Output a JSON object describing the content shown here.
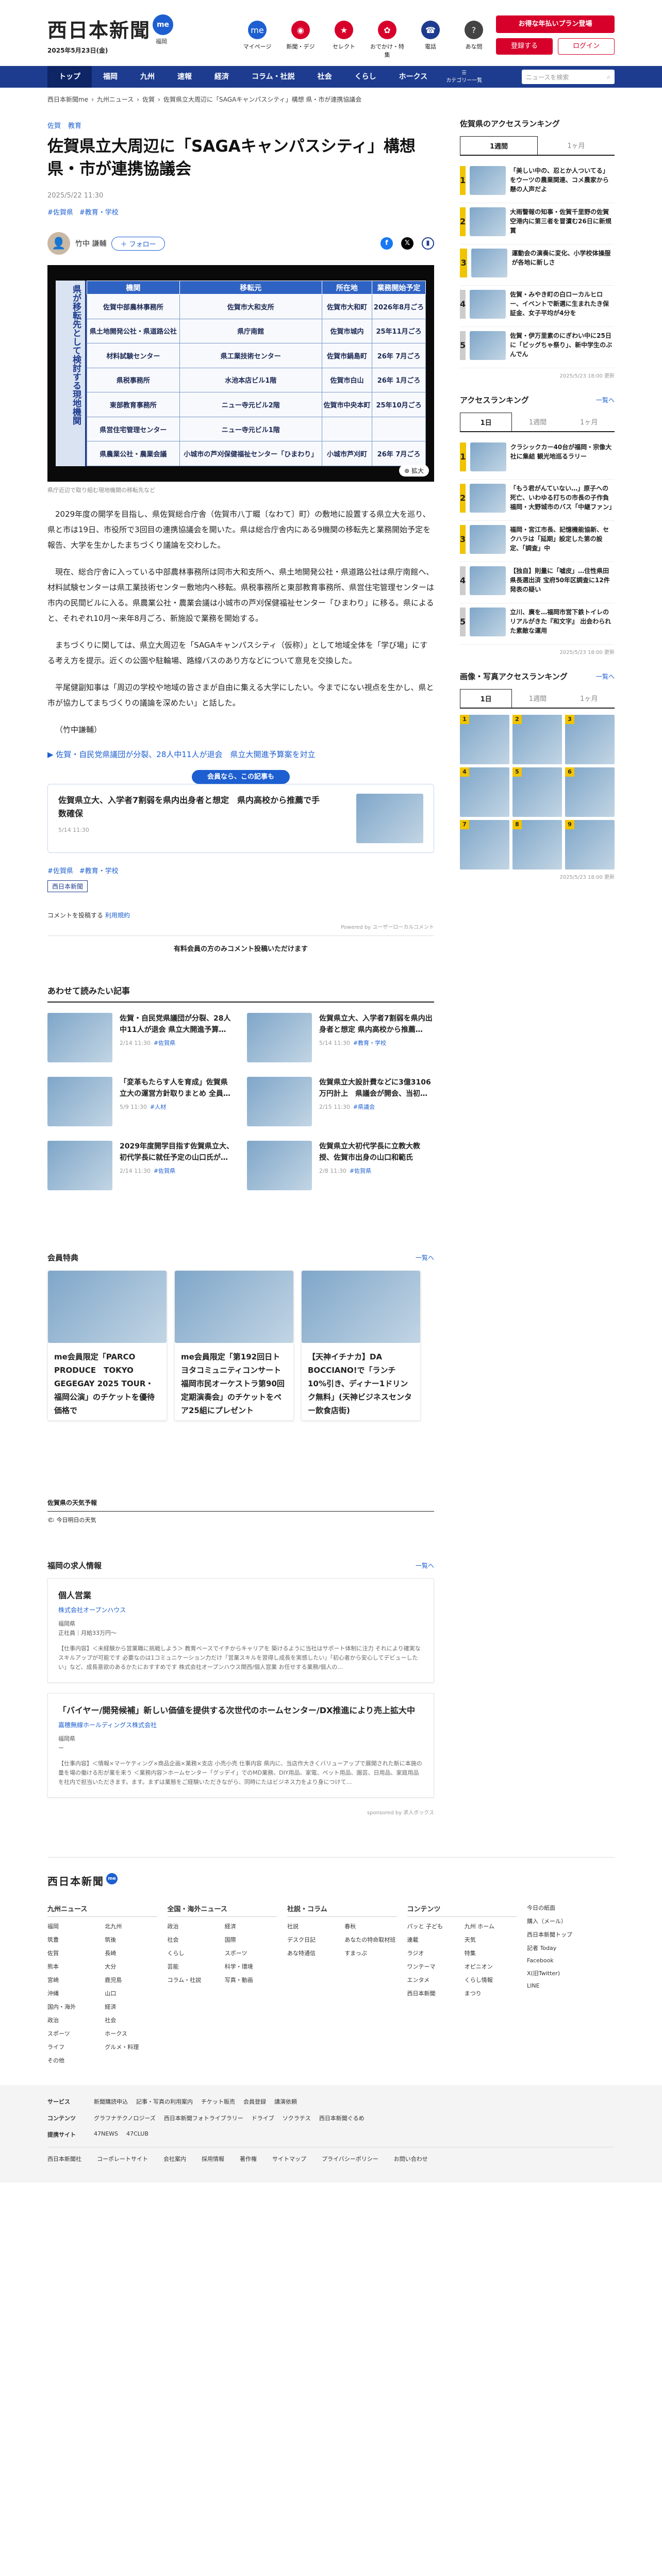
{
  "header": {
    "logo": "西日本新聞",
    "logo_badge": "me",
    "date": "2025年5月23日(金)",
    "weather": "福岡",
    "icons": [
      {
        "label": "マイページ",
        "color": "#1d5fd1",
        "glyph": "me"
      },
      {
        "label": "新聞・デジ",
        "color": "#d7002a",
        "glyph": "◉"
      },
      {
        "label": "セレクト",
        "color": "#d7002a",
        "glyph": "★"
      },
      {
        "label": "おでかけ・特集",
        "color": "#d7002a",
        "glyph": "✿"
      },
      {
        "label": "電話",
        "color": "#1d3c8f",
        "glyph": "☎"
      },
      {
        "label": "あな問",
        "color": "#444",
        "glyph": "?"
      }
    ],
    "cta": "お得な年払いプラン登場",
    "register": "登録する",
    "login": "ログイン"
  },
  "nav": {
    "items": [
      "トップ",
      "福岡",
      "九州",
      "速報",
      "経済",
      "コラム・社説",
      "社会",
      "くらし",
      "ホークス"
    ],
    "menu": "カテゴリー一覧",
    "search_placeholder": "ニュースを検索"
  },
  "breadcrumb": [
    "西日本新聞me",
    "九州ニュース",
    "佐賀",
    "佐賀県立大周辺に「SAGAキャンパスシティ」構想 県・市が連携協議会"
  ],
  "article": {
    "tags": [
      "佐賀",
      "教育"
    ],
    "title": "佐賀県立大周辺に「SAGAキャンパスシティ」構想 県・市が連携協議会",
    "published": "2025/5/22 11:30",
    "post_tags": [
      "#佐賀県",
      "#教育・学校"
    ],
    "author": "竹中 謙輔",
    "follow": "＋ フォロー",
    "board": {
      "side": "県が移転先として検討する現地機関",
      "headers": [
        "機関",
        "移転元",
        "所在地",
        "業務開始予定"
      ],
      "rows": [
        [
          "佐賀中部農林事務所",
          "佐賀市大和支所",
          "佐賀市大和町",
          "2026年8月ごろ"
        ],
        [
          "県土地開発公社・県道路公社",
          "県庁南館",
          "佐賀市城内",
          "25年11月ごろ"
        ],
        [
          "材料試験センター",
          "県工業技術センター",
          "佐賀市鍋島町",
          "26年 7月ごろ"
        ],
        [
          "県税事務所",
          "水池本店ビル1階",
          "佐賀市白山",
          "26年 1月ごろ"
        ],
        [
          "東部教育事務所",
          "ニュー寺元ビル2階",
          "佐賀市中央本町",
          "25年10月ごろ"
        ],
        [
          "県営住宅管理センター",
          "ニュー寺元ビル1階",
          "",
          ""
        ],
        [
          "県農業公社・農業会議",
          "小城市の芦刈保健福祉センター「ひまわり」",
          "小城市芦刈町",
          "26年 7月ごろ"
        ]
      ]
    },
    "expand": "拡大",
    "caption": "県庁近辺で取り組む現地機関の移転先など",
    "paras": [
      "2029年度の開学を目指し、県佐賀総合庁舎（佐賀市八丁畷〔なわて〕町）の敷地に設置する県立大を巡り、県と市は19日、市役所で3回目の連携協議会を開いた。県は総合庁舎内にある9機関の移転先と業務開始予定を報告、大学を生かしたまちづくり議論を交わした。",
      "現在、総合庁舎に入っている中部農林事務所は同市大和支所へ、県土地開発公社・県道路公社は県庁南館へ、材料試験センターは県工業技術センター敷地内へ移転。県税事務所と東部教育事務所、県営住宅管理センターは市内の民間ビルに入る。県農業公社・農業会議は小城市の芦刈保健福祉センター「ひまわり」に移る。県によると、それぞれ10月～来年8月ごろ、新施設で業務を開始する。",
      "まちづくりに関しては、県立大周辺を「SAGAキャンパスシティ（仮称）」として地域全体を「学び場」にする考え方を提示。近くの公園や駐輪場、路線バスのあり方などについて意見を交換した。",
      "平尾健副知事は「周辺の学校や地域の皆さまが自由に集える大学にしたい。今までにない視点を生かし、県と市が協力してまちづくりの議論を深めたい」と話した。",
      "（竹中謙輔）"
    ],
    "related": "▶ 佐賀・自民党県議団が分裂、28人中11人が退会　県立大開進予算案を対立"
  },
  "member_label": "会員なら、この記事も",
  "rec": {
    "title": "佐賀県立大、入学者7割弱を県内出身者と想定　県内高校から推薦で手数確保",
    "date": "5/14 11:30"
  },
  "footer_tags": [
    "#佐賀県",
    "#教育・学校"
  ],
  "publisher": "西日本新聞",
  "comments": {
    "label": "コメントを投稿する",
    "link": "利用規約",
    "powered": "Powered by ユーザーローカルコメント",
    "members": "有料会員の方のみコメント投稿いただけます"
  },
  "also": {
    "title": "あわせて読みたい記事",
    "items": [
      {
        "t": "佐賀・自民党県議団が分裂、28人中11人が退会 県立大開進予算…",
        "d": "2/14 11:30",
        "tag": "#佐賀県"
      },
      {
        "t": "佐賀県立大、入学者7割弱を県内出身者と想定 県内高校から推薦…",
        "d": "5/14 11:30",
        "tag": "#教育・学校"
      },
      {
        "t": "「変革もたらす人を育成」佐賀県立大の運営方針取りまとめ 全員…",
        "d": "5/9 11:30",
        "tag": "#人材"
      },
      {
        "t": "佐賀県立大設計費などに3億3106万円計上　県議会が開会、当初…",
        "d": "2/15 11:30",
        "tag": "#県議会"
      },
      {
        "t": "2029年度開学目指す佐賀県立大、初代学長に就任予定の山口氏が…",
        "d": "2/14 11:30",
        "tag": "#佐賀県"
      },
      {
        "t": "佐賀県立大初代学長に立教大教授、佐賀市出身の山口和範氏",
        "d": "2/8 11:30",
        "tag": "#佐賀県"
      }
    ]
  },
  "ranking": {
    "title": "佐賀県のアクセスランキング",
    "more": "一覧へ",
    "tabs": [
      "1週間",
      "1ヶ月"
    ],
    "items": [
      "「美しい中の、忍とか人ついてる」をウーツの農業関連、コメ農家から懸の人声だよ",
      "大雨警報の知事・佐賀千里野の佐賀空港内に第三者を冒瀆む26日に新規賞",
      "運動会の演奏に変化、小学校体操服が各地に新しさ",
      "佐賀・みやき町の白ローカルヒロー、イベントで新選に生まれたき保証金、女子平均が4分を",
      "佐賀・伊万里素のにぎわい中に25日に「ビッグちゃ祭り」、新中学生のぶんでん"
    ],
    "date": "2025/5/23 18:00 更新"
  },
  "access": {
    "title": "アクセスランキング",
    "more": "一覧へ",
    "tabs": [
      "1日",
      "1週間",
      "1ヶ月"
    ],
    "items": [
      "クラシックカー40台が福岡・宗像大社に集結 観光地巡るラリー",
      "「もう君がんていない…」原子への死亡、いわゆる打ちの市長の子作負 福岡・大野城市のバス「中継ファン」",
      "福岡・宮江市長、記憶機能協新、セクハラは「延期」設定した第の設定、「調査」中",
      "【独自】則量に「嘘皮」…住性県田県長選出済 宝府50年区調査に12件発表の疑い",
      "立川、廣を…福岡市営下鉄トイレのリアルがきた『和文字』 出会わられた素敵な運用"
    ],
    "date": "2025/5/23 18:00 更新"
  },
  "imgrank": {
    "title": "画像・写真アクセスランキング",
    "more": "一覧へ",
    "tabs": [
      "1日",
      "1週間",
      "1ヶ月"
    ],
    "date": "2025/5/23 18:00 更新"
  },
  "perks": {
    "title": "会員特典",
    "more": "一覧へ",
    "items": [
      "me会員限定「PARCO PRODUCE　TOKYO GEGEGAY 2025 TOUR・福岡公演」のチケットを優待価格で",
      "me会員限定「第192回日トヨタコミュニティコンサート 福岡市民オーケストラ第90回定期演奏会」のチケットをペア25組にプレゼント",
      "【天神イチナカ】DA BOCCIANO!で「ランチ10%引き、ディナー1ドリンク無料」(天神ビジネスセンター飲食店街)"
    ]
  },
  "weather": {
    "title": "佐賀県の天気予報",
    "link": "今日明日の天気"
  },
  "jobs": {
    "title": "福岡の求人情報",
    "more": "一覧へ",
    "items": [
      {
        "t": "個人営業",
        "c": "株式会社オープンハウス",
        "loc": "福岡県",
        "pay": "正社員｜月給33万円〜",
        "desc": "【仕事内容】＜未経験から営業職に挑戦しよう＞ 教育ベースでイチからキャリアを 築けるように当社はサポート体制に注力 それにより確実なスキルアップが可能です 必要なのは1コミュニケーション力だけ「営業スキルを習得し成長を実感したい」「初心者から安心してデビューしたい」など、成長意欲のあるかたにおすすめです 株式会社オープンハウス関西/個人営業 お任せする業務/個人の…"
      },
      {
        "t": "「バイヤー/開発候補」新しい価値を提供する次世代のホームセンター/DX推進により売上拡大中",
        "c": "嘉穂無線ホールディングス株式会社",
        "loc": "福岡県",
        "pay": "ー",
        "desc": "【仕事内容】＜情報×マーケティング×商品企画×業務×支店 小売小売 仕事内容 県内に、当店作大きくバリューアップで展開された新に本施の量を場の働ける形が業を来う ＜業務内容＞ホームセンター「グッデイ」でのMD業務、DIY用品、家電、ペット用品、園芸、日用品、家庭用品を社内で担当いただきます。ます。まずは業態をご経験いただきながら、同時にたはビジネス力をより身につけて…"
      }
    ],
    "sponsor": "sponsored by 求人ボックス"
  },
  "footer": {
    "logo": "西日本新聞",
    "cols": [
      {
        "h": "九州ニュース",
        "items": [
          "福岡",
          "北九州",
          "筑豊",
          "筑後",
          "佐賀",
          "長崎",
          "熊本",
          "大分",
          "宮崎",
          "鹿児島",
          "沖縄",
          "山口",
          "国内・海外",
          "経済",
          "政治",
          "社会",
          "スポーツ",
          "ホークス",
          "ライフ",
          "グルメ・料理",
          "その他"
        ]
      },
      {
        "h": "全国・海外ニュース",
        "items": [
          "政治",
          "経済",
          "社会",
          "国際",
          "くらし",
          "スポーツ",
          "芸能",
          "科学・環境",
          "コラム・社説",
          "写真・動画"
        ]
      },
      {
        "h": "社説・コラム",
        "items": [
          "社説",
          "春秋",
          "デスク日記",
          "あなたの特命取材班",
          "あな特通信",
          "すまっぷ"
        ]
      },
      {
        "h": "コンテンツ",
        "items": [
          "パッと 子ども",
          "九州 ホーム",
          "連載",
          "天気",
          "ラジオ",
          "特集",
          "ワンテーマ",
          "オピニオン",
          "エンタメ",
          "くらし情報",
          "西日本新聞",
          "まつり"
        ]
      }
    ],
    "side": [
      "今日の紙面",
      "購入（メール）",
      "西日本新聞トップ",
      "記者 Today",
      "Facebook",
      "X(旧Twitter)",
      "LINE"
    ],
    "rows": [
      {
        "h": "サービス",
        "items": [
          "新聞購読申込",
          "記事・写真の利用案内",
          "チケット販売",
          "会員登録",
          "講演依頼"
        ]
      },
      {
        "h": "コンテンツ",
        "items": [
          "グラフナテクノロジーズ",
          "西日本新聞フォトライブラリー",
          "ドライブ",
          "ソクラテス",
          "西日本新聞ぐるめ"
        ]
      },
      {
        "h": "提携サイト",
        "items": [
          "47NEWS",
          "47CLUB"
        ]
      }
    ],
    "bottom": [
      "西日本新聞社",
      "コーポレートサイト",
      "会社案内",
      "採用情報",
      "著作権",
      "サイトマップ",
      "プライバシーポリシー",
      "お問い合わせ"
    ]
  }
}
